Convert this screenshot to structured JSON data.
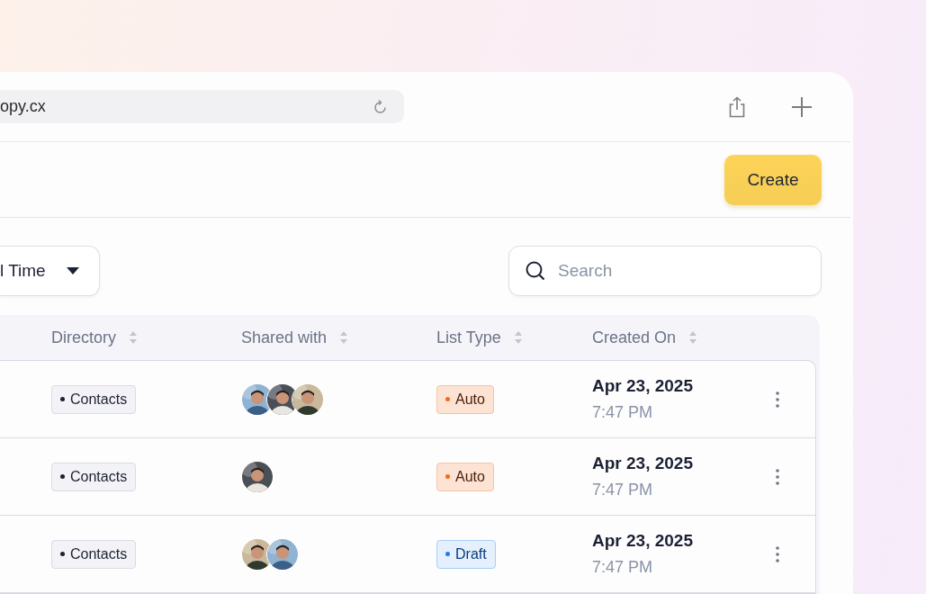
{
  "browser": {
    "address": "opy.cx"
  },
  "header": {
    "create_button": "Create"
  },
  "filters": {
    "date_range": "l Time",
    "search": {
      "placeholder": "Search"
    }
  },
  "table": {
    "columns": [
      "Directory",
      "Shared with",
      "List Type",
      "Created On"
    ],
    "rows": [
      {
        "directory": "Contacts",
        "list_type": {
          "label": "Auto",
          "kind": "auto"
        },
        "created_date": "Apr 23, 2025",
        "created_time": "7:47 PM"
      },
      {
        "directory": "Contacts",
        "list_type": {
          "label": "Auto",
          "kind": "auto"
        },
        "created_date": "Apr 23, 2025",
        "created_time": "7:47 PM"
      },
      {
        "directory": "Contacts",
        "list_type": {
          "label": "Draft",
          "kind": "draft"
        },
        "created_date": "Apr 23, 2025",
        "created_time": "7:47 PM"
      }
    ]
  }
}
